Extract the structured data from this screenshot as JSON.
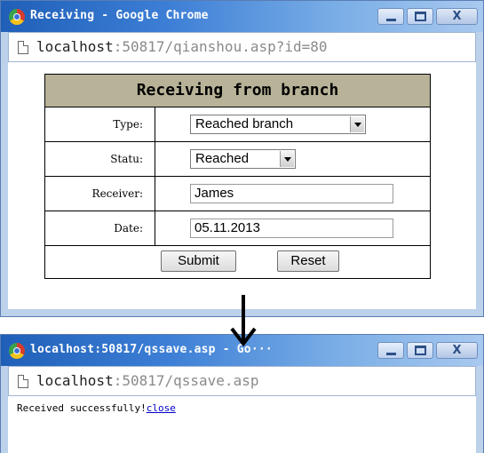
{
  "window1": {
    "title": "Receiving - Google Chrome",
    "address_host": "localhost",
    "address_rest": ":50817/qianshou.asp?id=80",
    "form": {
      "heading": "Receiving from branch",
      "type_label": "Type:",
      "type_value": "Reached branch",
      "status_label": "Statu:",
      "status_value": "Reached",
      "receiver_label": "Receiver:",
      "receiver_value": "James",
      "date_label": "Date:",
      "date_value": "05.11.2013",
      "submit_label": "Submit",
      "reset_label": "Reset"
    }
  },
  "window2": {
    "title": "localhost:50817/qssave.asp - Go···",
    "address_host": "localhost",
    "address_rest": ":50817/qssave.asp",
    "message": "Received successfully!",
    "close_link": "close"
  },
  "window_buttons": {
    "close_glyph": "X"
  },
  "colors": {
    "titlebar_start": "#1f5fb8",
    "window_frame": "#bcd1ea",
    "form_header_bg": "#b8b398",
    "link": "#0000cc"
  },
  "icons": [
    "chrome-logo-icon",
    "page-icon",
    "minimize-icon",
    "maximize-icon",
    "close-icon",
    "down-arrow-icon",
    "dropdown-arrow-icon"
  ]
}
